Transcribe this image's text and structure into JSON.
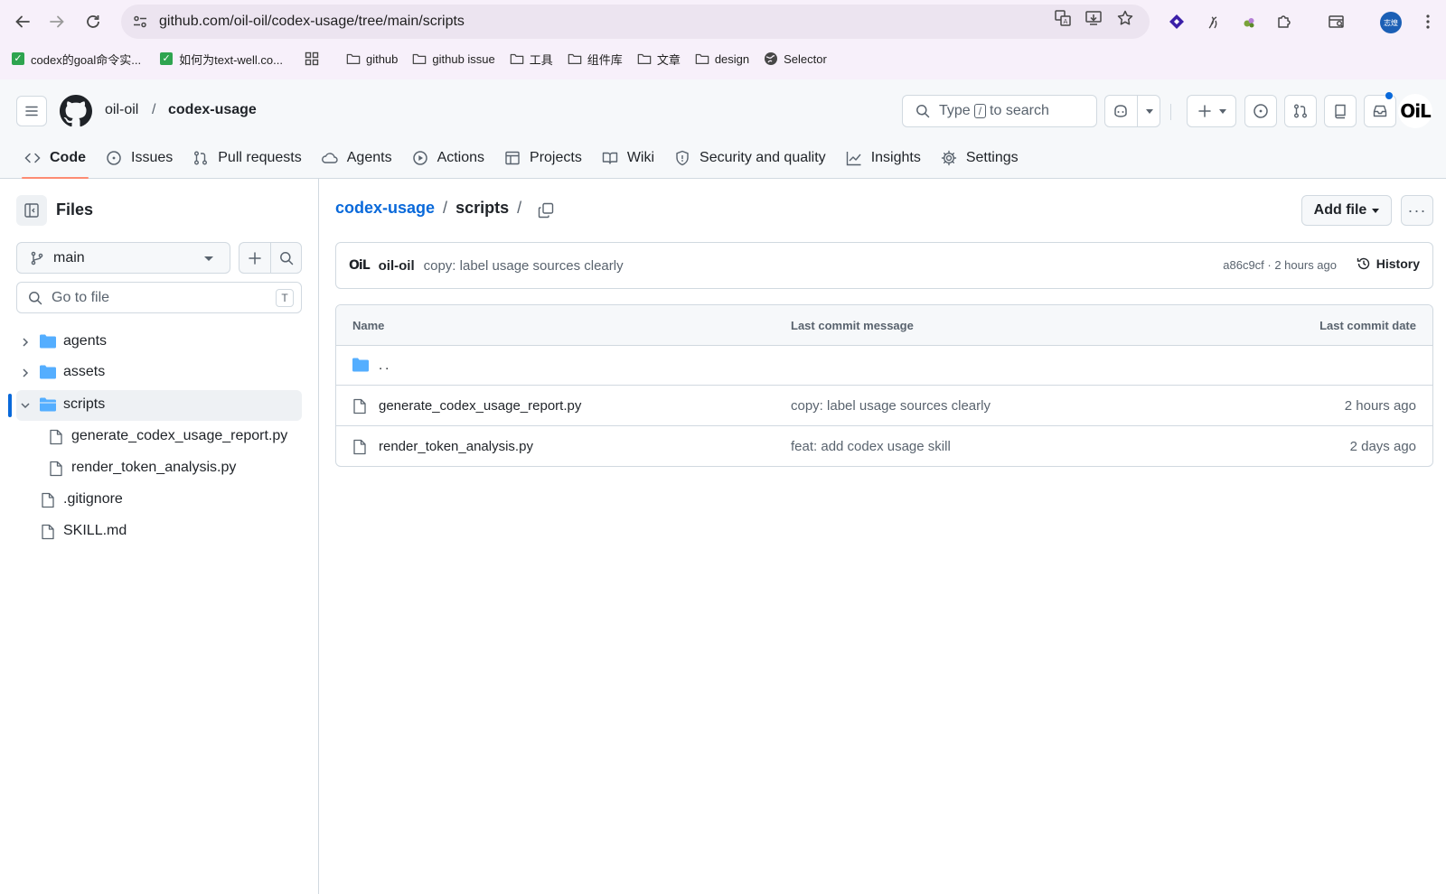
{
  "browser": {
    "url": "github.com/oil-oil/codex-usage/tree/main/scripts",
    "profile_initials": "志煌",
    "bookmarks": [
      {
        "label": "codex的goal命令实...",
        "icon": "check-icon"
      },
      {
        "label": "如何为text-well.co...",
        "icon": "check-icon"
      },
      {
        "label": "",
        "icon": "apps-grid-icon"
      },
      {
        "label": "github",
        "icon": "folder-icon"
      },
      {
        "label": "github issue",
        "icon": "folder-icon"
      },
      {
        "label": "工具",
        "icon": "folder-icon"
      },
      {
        "label": "组件库",
        "icon": "folder-icon"
      },
      {
        "label": "文章",
        "icon": "folder-icon"
      },
      {
        "label": "design",
        "icon": "folder-icon"
      },
      {
        "label": "Selector",
        "icon": "globe-icon"
      }
    ]
  },
  "header": {
    "owner": "oil-oil",
    "separator": "/",
    "repo": "codex-usage",
    "search_prefix": "Type",
    "search_key": "/",
    "search_suffix": "to search",
    "avatar_text": "OiL"
  },
  "tabs": [
    {
      "label": "Code",
      "icon": "code-icon",
      "active": true
    },
    {
      "label": "Issues",
      "icon": "issue-icon"
    },
    {
      "label": "Pull requests",
      "icon": "pull-request-icon"
    },
    {
      "label": "Agents",
      "icon": "agents-icon"
    },
    {
      "label": "Actions",
      "icon": "play-icon"
    },
    {
      "label": "Projects",
      "icon": "table-icon"
    },
    {
      "label": "Wiki",
      "icon": "book-icon"
    },
    {
      "label": "Security and quality",
      "icon": "shield-icon"
    },
    {
      "label": "Insights",
      "icon": "graph-icon"
    },
    {
      "label": "Settings",
      "icon": "gear-icon"
    }
  ],
  "sidebar": {
    "title": "Files",
    "branch": "main",
    "goto_placeholder": "Go to file",
    "goto_key": "T",
    "tree": [
      {
        "name": "agents",
        "type": "folder",
        "expanded": false
      },
      {
        "name": "assets",
        "type": "folder",
        "expanded": false
      },
      {
        "name": "scripts",
        "type": "folder",
        "expanded": true,
        "selected": true
      },
      {
        "name": "generate_codex_usage_report.py",
        "type": "file",
        "depth": 1
      },
      {
        "name": "render_token_analysis.py",
        "type": "file",
        "depth": 1
      },
      {
        "name": ".gitignore",
        "type": "file"
      },
      {
        "name": "SKILL.md",
        "type": "file"
      }
    ]
  },
  "main": {
    "breadcrumb_repo": "codex-usage",
    "breadcrumb_sep": "/",
    "breadcrumb_dir": "scripts",
    "breadcrumb_trail": "/",
    "add_file_label": "Add file",
    "more_label": "···",
    "commit": {
      "avatar_text": "OiL",
      "author": "oil-oil",
      "message": "copy: label usage sources clearly",
      "meta": "a86c9cf · 2 hours ago",
      "history_label": "History"
    },
    "table": {
      "headers": {
        "name": "Name",
        "message": "Last commit message",
        "date": "Last commit date"
      },
      "parent_dir": "..",
      "rows": [
        {
          "name": "generate_codex_usage_report.py",
          "message": "copy: label usage sources clearly",
          "date": "2 hours ago"
        },
        {
          "name": "render_token_analysis.py",
          "message": "feat: add codex usage skill",
          "date": "2 days ago"
        }
      ]
    }
  }
}
